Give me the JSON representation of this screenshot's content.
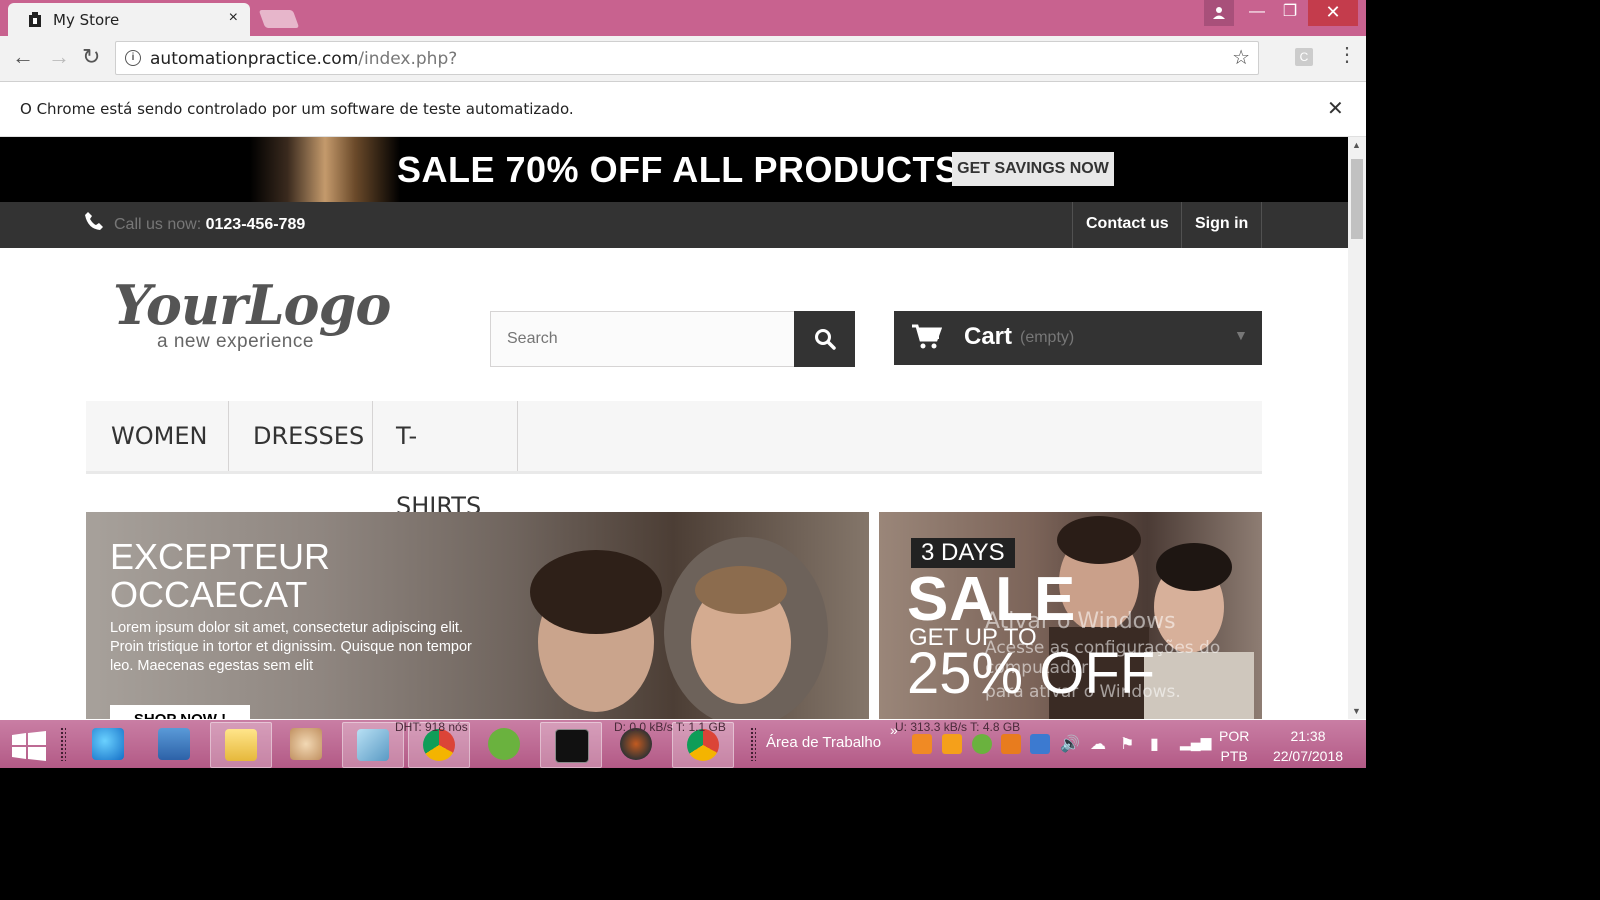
{
  "browser": {
    "tab_title": "My Store",
    "tab_close": "×",
    "url_domain": "automationpractice.com",
    "url_path": "/index.php?",
    "back": "←",
    "forward": "→",
    "reload": "↻",
    "bookmark": "☆",
    "extension": "C",
    "menu": "⋮",
    "info": "i",
    "infobar_message": "O Chrome está sendo controlado por um software de teste automatizado.",
    "infobar_close": "✕",
    "window": {
      "minimize": "—",
      "maximize": "❐",
      "close": "✕"
    }
  },
  "page": {
    "banner": {
      "headline": "SALE 70% OFF ALL PRODUCTS",
      "cta": "GET SAVINGS NOW"
    },
    "nav": {
      "call_prefix": "Call us now:",
      "phone": "0123-456-789",
      "contact": "Contact us",
      "signin": "Sign in"
    },
    "logo": {
      "main": "YourLogo",
      "tagline": "a new experience"
    },
    "search": {
      "placeholder": "Search"
    },
    "cart": {
      "label": "Cart",
      "status": "(empty)"
    },
    "menu": [
      "WOMEN",
      "DRESSES",
      "T-SHIRTS"
    ],
    "slider": {
      "heading_line1": "EXCEPTEUR",
      "heading_line2": "OCCAECAT",
      "body": "Lorem ipsum dolor sit amet, consectetur adipiscing elit. Proin tristique in tortor et dignissim. Quisque non tempor leo. Maecenas egestas sem elit",
      "button": "SHOP NOW !"
    },
    "promo": {
      "days": "3 DAYS",
      "sale": "SALE",
      "up_to": "GET UP TO",
      "percent": "25% OFF"
    }
  },
  "windows": {
    "watermark_title": "Ativar o Windows",
    "watermark_line2": "Acesse as configurações do computador",
    "watermark_line3": "para ativar o Windows."
  },
  "taskbar": {
    "desktop_label": "Área de Trabalho",
    "chevron": "»",
    "dht": "DHT: 918 nós",
    "down": "D: 0.0 kB/s T: 1.1 GB",
    "up": "U: 313.3 kB/s T: 4.8 GB",
    "lang_top": "POR",
    "lang_bottom": "PTB",
    "time": "21:38",
    "date": "22/07/2018",
    "accent": "#b35a86"
  }
}
